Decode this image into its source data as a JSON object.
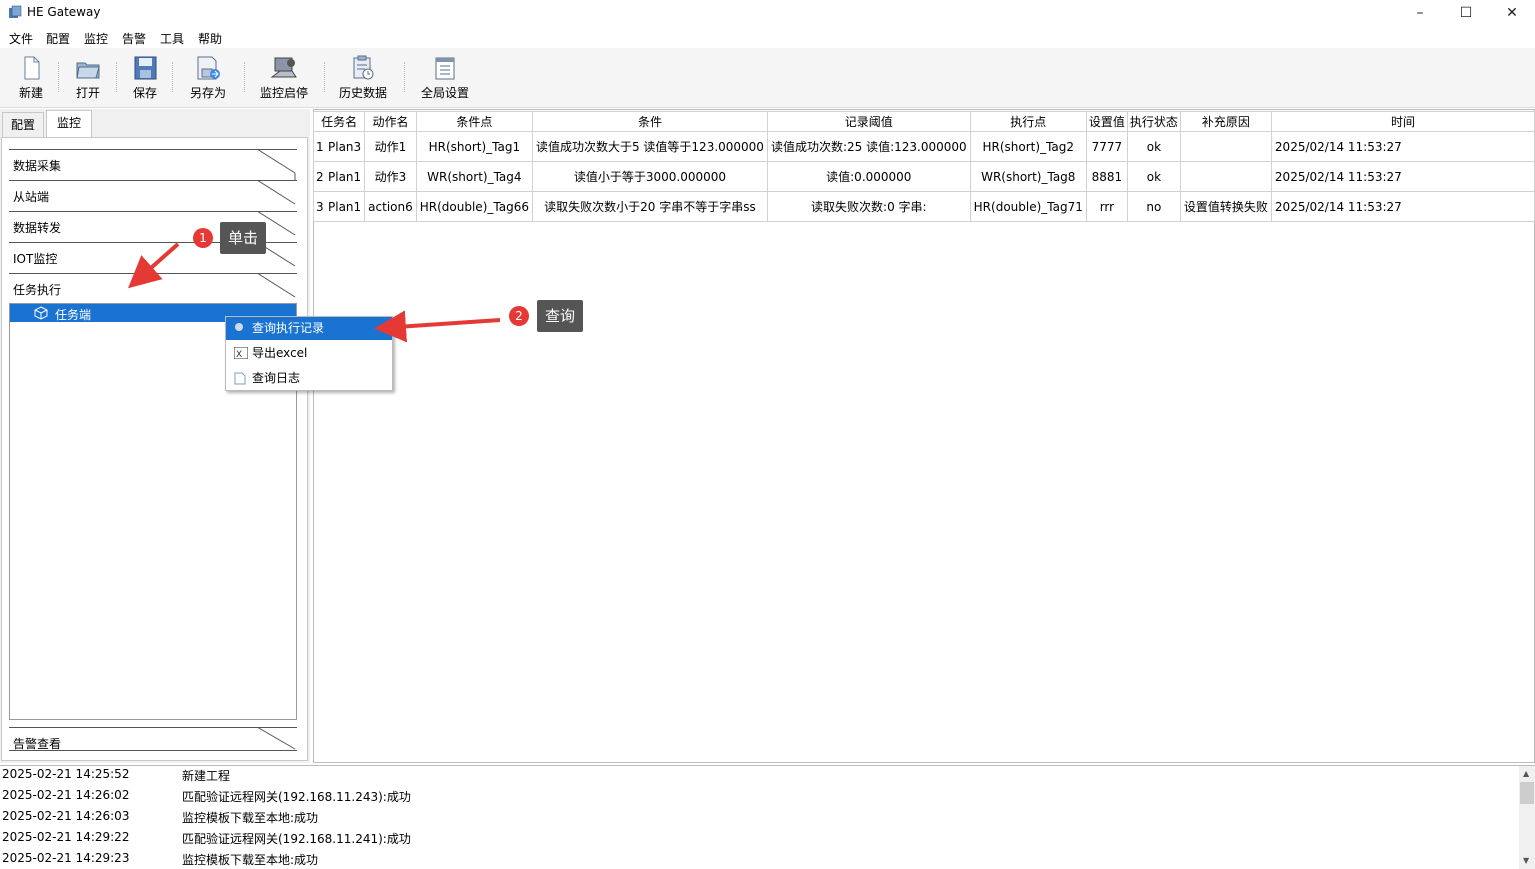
{
  "window": {
    "title": "HE Gateway"
  },
  "menu": [
    "文件",
    "配置",
    "监控",
    "告警",
    "工具",
    "帮助"
  ],
  "toolbar": [
    {
      "label": "新建",
      "icon": "new-file-icon"
    },
    {
      "label": "打开",
      "icon": "open-folder-icon"
    },
    {
      "label": "保存",
      "icon": "save-icon"
    },
    {
      "label": "另存为",
      "icon": "save-as-icon"
    },
    {
      "label": "监控启停",
      "icon": "monitor-start-stop-icon"
    },
    {
      "label": "历史数据",
      "icon": "history-data-icon"
    },
    {
      "label": "全局设置",
      "icon": "global-settings-icon"
    }
  ],
  "left_tabs": [
    "配置",
    "监控"
  ],
  "sections": [
    "数据采集",
    "从站端",
    "数据转发",
    "IOT监控",
    "任务执行"
  ],
  "tree_item": "任务端",
  "bottom_section": "告警查看",
  "context_menu": [
    "查询执行记录",
    "导出excel",
    "查询日志"
  ],
  "annotations": {
    "one": {
      "num": "1",
      "text": "单击"
    },
    "two": {
      "num": "2",
      "text": "查询"
    }
  },
  "table": {
    "headers": [
      "任务名",
      "动作名",
      "条件点",
      "条件",
      "记录阈值",
      "执行点",
      "设置值",
      "执行状态",
      "补充原因",
      "时间"
    ],
    "rows": [
      {
        "n": "1",
        "cells": [
          "Plan3",
          "动作1",
          "HR(short)_Tag1",
          "读值成功次数大于5 读值等于123.000000",
          "读值成功次数:25 读值:123.000000",
          "HR(short)_Tag2",
          "7777",
          "ok",
          "",
          "2025/02/14 11:53:27"
        ]
      },
      {
        "n": "2",
        "cells": [
          "Plan1",
          "动作3",
          "WR(short)_Tag4",
          "读值小于等于3000.000000",
          "读值:0.000000",
          "WR(short)_Tag8",
          "8881",
          "ok",
          "",
          "2025/02/14 11:53:27"
        ]
      },
      {
        "n": "3",
        "cells": [
          "Plan1",
          "action6",
          "HR(double)_Tag66",
          "读取失败次数小于20 字串不等于字串ss",
          "读取失败次数:0 字串:",
          "HR(double)_Tag71",
          "rrr",
          "no",
          "设置值转换失败",
          "2025/02/14 11:53:27"
        ]
      }
    ]
  },
  "log": [
    {
      "time": "2025-02-21 14:25:52",
      "msg": "新建工程"
    },
    {
      "time": "2025-02-21 14:26:02",
      "msg": "匹配验证远程网关(192.168.11.243):成功"
    },
    {
      "time": "2025-02-21 14:26:03",
      "msg": "监控模板下载至本地:成功"
    },
    {
      "time": "2025-02-21 14:29:22",
      "msg": "匹配验证远程网关(192.168.11.241):成功"
    },
    {
      "time": "2025-02-21 14:29:23",
      "msg": "监控模板下载至本地:成功"
    }
  ],
  "colors": {
    "selection": "#1a73d0",
    "annotation_red": "#e53935",
    "callout_bg": "#555555"
  }
}
